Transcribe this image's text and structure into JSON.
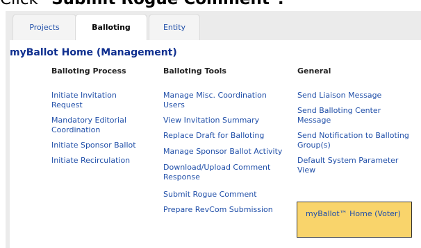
{
  "instruction": {
    "prefix": "Click ",
    "target": "\"Submit Rogue Comment\"."
  },
  "tabs": [
    {
      "label": "Projects",
      "active": false
    },
    {
      "label": "Balloting",
      "active": true
    },
    {
      "label": "Entity",
      "active": false
    }
  ],
  "page_title": "myBallot Home (Management)",
  "columns": {
    "process": {
      "heading": "Balloting Process",
      "links": [
        "Initiate Invitation Request",
        "Mandatory Editorial Coordination",
        "Initiate Sponsor Ballot",
        "Initiate Recirculation"
      ]
    },
    "tools": {
      "heading": "Balloting Tools",
      "links": [
        "Manage Misc. Coordination Users",
        "View Invitation Summary",
        "Replace Draft for Balloting",
        "Manage Sponsor Ballot Activity",
        "Download/Upload Comment Response",
        "Submit Rogue Comment",
        "Prepare RevCom Submission"
      ]
    },
    "general": {
      "heading": "General",
      "links": [
        "Send Liaison Message",
        "Send Balloting Center Message",
        "Send Notification to Balloting Group(s)",
        "Default System Parameter View"
      ],
      "voter_home": "myBallot™ Home (Voter)"
    }
  },
  "colors": {
    "link": "#1f4ea8",
    "title": "#0f2f8f",
    "highlight_box": "#f9d46b",
    "frame_bg": "#ebebeb"
  }
}
